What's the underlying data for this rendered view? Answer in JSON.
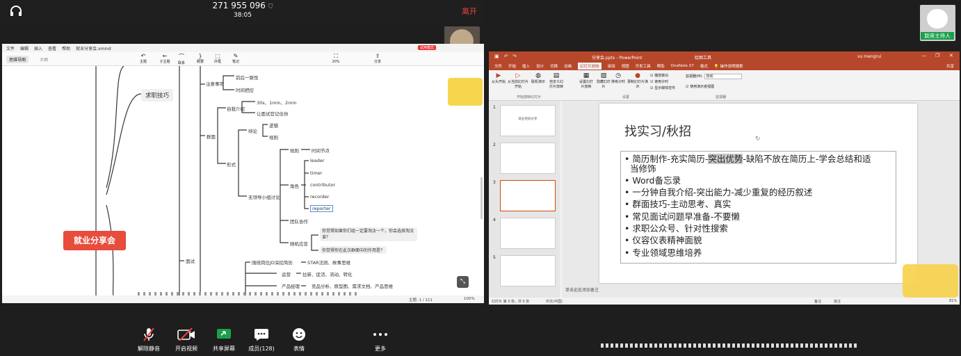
{
  "header": {
    "meeting_id": "271 955 096",
    "duration": "38:05",
    "leave_label": "离开"
  },
  "participants": {
    "co_host_label": "联席主持人"
  },
  "mindmap": {
    "menu": [
      "文件",
      "编辑",
      "插入",
      "查看",
      "帮助",
      "就业分享会.xmind"
    ],
    "trial_badge": "试用模式",
    "tab_active": "思维导图",
    "tab_other": "大纲",
    "tools": [
      "主题",
      "子主题",
      "联系",
      "概要",
      "外框",
      "笔记"
    ],
    "zoom_tool": "20%",
    "share_tool": "分享",
    "root": "就业分享会",
    "branch1": "求职技巧",
    "nodes": {
      "attention": "注意事项",
      "consistency": "前后一致性",
      "timing": "时间把控",
      "group_interview": "群面",
      "self_intro": "自我介绍",
      "times": "30s、1min、2min",
      "remember": "让面试官记住你",
      "form": "形式",
      "debate": "辩论",
      "logic": "逻辑",
      "rules": "规则",
      "leaderless": "无领导小组讨论",
      "rule": "规则",
      "time_node": "时间节点",
      "role": "角色",
      "leader": "leader",
      "timer": "timer",
      "contributor": "contributor",
      "recorder": "recorder",
      "reporter": "reporter",
      "teamwork": "团队协作",
      "random": "随机应变",
      "q1": "你觉得如果你们组一定要淘汰一个，你会选择淘汰谁？",
      "q2": "你觉得你在此次群面中的作用是？",
      "interview": "面试",
      "star": "围绕岗位JD深挖简历",
      "star_method": "STAR法则、故事思维",
      "ops": "运营",
      "ops_skills": "拉新、促活、流动、转化",
      "pm": "产品经理",
      "pm_skills": "竞品分析、原型图、需求文档、产品思维"
    },
    "status_topics": "主题: 1 / 111",
    "status_zoom": "100%"
  },
  "ppt": {
    "title": "分享会.pptx - PowerPoint",
    "drawing_tools": "绘图工具",
    "user": "xu mengrui",
    "tabs": [
      "文件",
      "开始",
      "插入",
      "设计",
      "切换",
      "动画",
      "幻灯片放映",
      "审阅",
      "视图",
      "开发工具",
      "帮助",
      "OneNote X7",
      "格式"
    ],
    "search": "操作说明搜索",
    "share": "共享",
    "ribbon_groups": [
      "开始放映幻灯片",
      "设置",
      "监视器"
    ],
    "ribbon_buttons": [
      "从头开始",
      "从当前幻灯片开始",
      "联机演示",
      "自定义幻灯片放映",
      "设置幻灯片放映",
      "隐藏幻灯片",
      "排练计时",
      "录制幻灯片演示"
    ],
    "ribbon_checks": [
      "播放旁白",
      "使用计时",
      "显示媒体控件"
    ],
    "monitor_label": "监视器(M):",
    "monitor_value": "自动",
    "presenter_view": "使用演示者视图",
    "thumb_nums": [
      "1",
      "2",
      "3",
      "4",
      "5"
    ],
    "thumb1_title": "就业经验分享",
    "slide_title": "找实习/秋招",
    "bullets": [
      {
        "pre": "简历制作-充实简历-",
        "hl": "突出优势",
        "post": "-缺陷不放在简历上-学会总结和适"
      },
      {
        "text": "当修饰"
      },
      {
        "text": "Word备忘录"
      },
      {
        "text": "一分钟自我介绍-突出能力-减少重复的经历叙述"
      },
      {
        "text": "群面技巧-主动思考、真实"
      },
      {
        "text": "常见面试问题早准备-不要懒"
      },
      {
        "text": "求职公众号、针对性搜索"
      },
      {
        "text": "仪容仪表精神面貌"
      },
      {
        "text": "专业领域思维培养"
      }
    ],
    "notes": "单击此处添加备注",
    "status_left": "幻灯片 第 3 张，共 5 张",
    "status_lang": "中文(中国)",
    "status_notes": "备注",
    "status_comments": "批注",
    "status_zoom": "81%"
  },
  "controls": {
    "mute": "解除静音",
    "video": "开启视频",
    "share": "共享屏幕",
    "members": "成员(128)",
    "emoji": "表情",
    "more": "更多"
  }
}
